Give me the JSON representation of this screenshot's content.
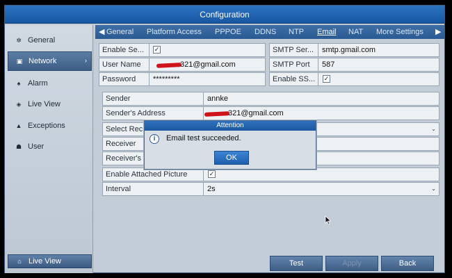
{
  "window": {
    "title": "Configuration"
  },
  "sidebar": {
    "items": [
      {
        "label": "General",
        "icon": "gear-icon",
        "glyph": "✲"
      },
      {
        "label": "Network",
        "icon": "network-icon",
        "glyph": "▣",
        "chevron": "›"
      },
      {
        "label": "Alarm",
        "icon": "alarm-icon",
        "glyph": "♠"
      },
      {
        "label": "Live View",
        "icon": "eye-icon",
        "glyph": "◈"
      },
      {
        "label": "Exceptions",
        "icon": "warning-icon",
        "glyph": "▲"
      },
      {
        "label": "User",
        "icon": "users-icon",
        "glyph": "☗"
      }
    ],
    "bottom_button": {
      "label": "Live View",
      "icon": "home-icon",
      "glyph": "⌂"
    }
  },
  "tabs": {
    "prev_arrow": "◀",
    "next_arrow": "▶",
    "items": [
      {
        "label": "General"
      },
      {
        "label": "Platform Access"
      },
      {
        "label": "PPPOE"
      },
      {
        "label": "DDNS"
      },
      {
        "label": "NTP"
      },
      {
        "label": "Email"
      },
      {
        "label": "NAT"
      },
      {
        "label": "More Settings"
      }
    ],
    "active": "Email"
  },
  "form": {
    "enable_server_auth": {
      "label": "Enable Se...",
      "checked": true,
      "mark": "✓"
    },
    "smtp_server": {
      "label": "SMTP Ser...",
      "value": "smtp.gmail.com"
    },
    "user_name": {
      "label": "User Name",
      "value": "321@gmail.com"
    },
    "smtp_port": {
      "label": "SMTP Port",
      "value": "587"
    },
    "password": {
      "label": "Password",
      "value": "*********"
    },
    "enable_ssl": {
      "label": "Enable SS...",
      "checked": true,
      "mark": "✓"
    },
    "sender": {
      "label": "Sender",
      "value": "annke"
    },
    "sender_address": {
      "label": "Sender's Address",
      "value": "321@gmail.com"
    },
    "select_receiver": {
      "label": "Select Rec",
      "arrow": "⌄"
    },
    "receiver": {
      "label": "Receiver"
    },
    "receiver_address": {
      "label": "Receiver's"
    },
    "enable_attached_picture": {
      "label": "Enable Attached Picture",
      "checked": true,
      "mark": "✓"
    },
    "interval": {
      "label": "Interval",
      "value": "2s",
      "arrow": "⌄"
    }
  },
  "dialog": {
    "title": "Attention",
    "icon": "info-icon",
    "icon_glyph": "i",
    "message": "Email test succeeded.",
    "ok_label": "OK"
  },
  "buttons": {
    "test": "Test",
    "apply": "Apply",
    "back": "Back"
  },
  "colors": {
    "title_bar": "#1c5aa6",
    "accent": "#2a5a93",
    "redaction": "#d0121b"
  }
}
